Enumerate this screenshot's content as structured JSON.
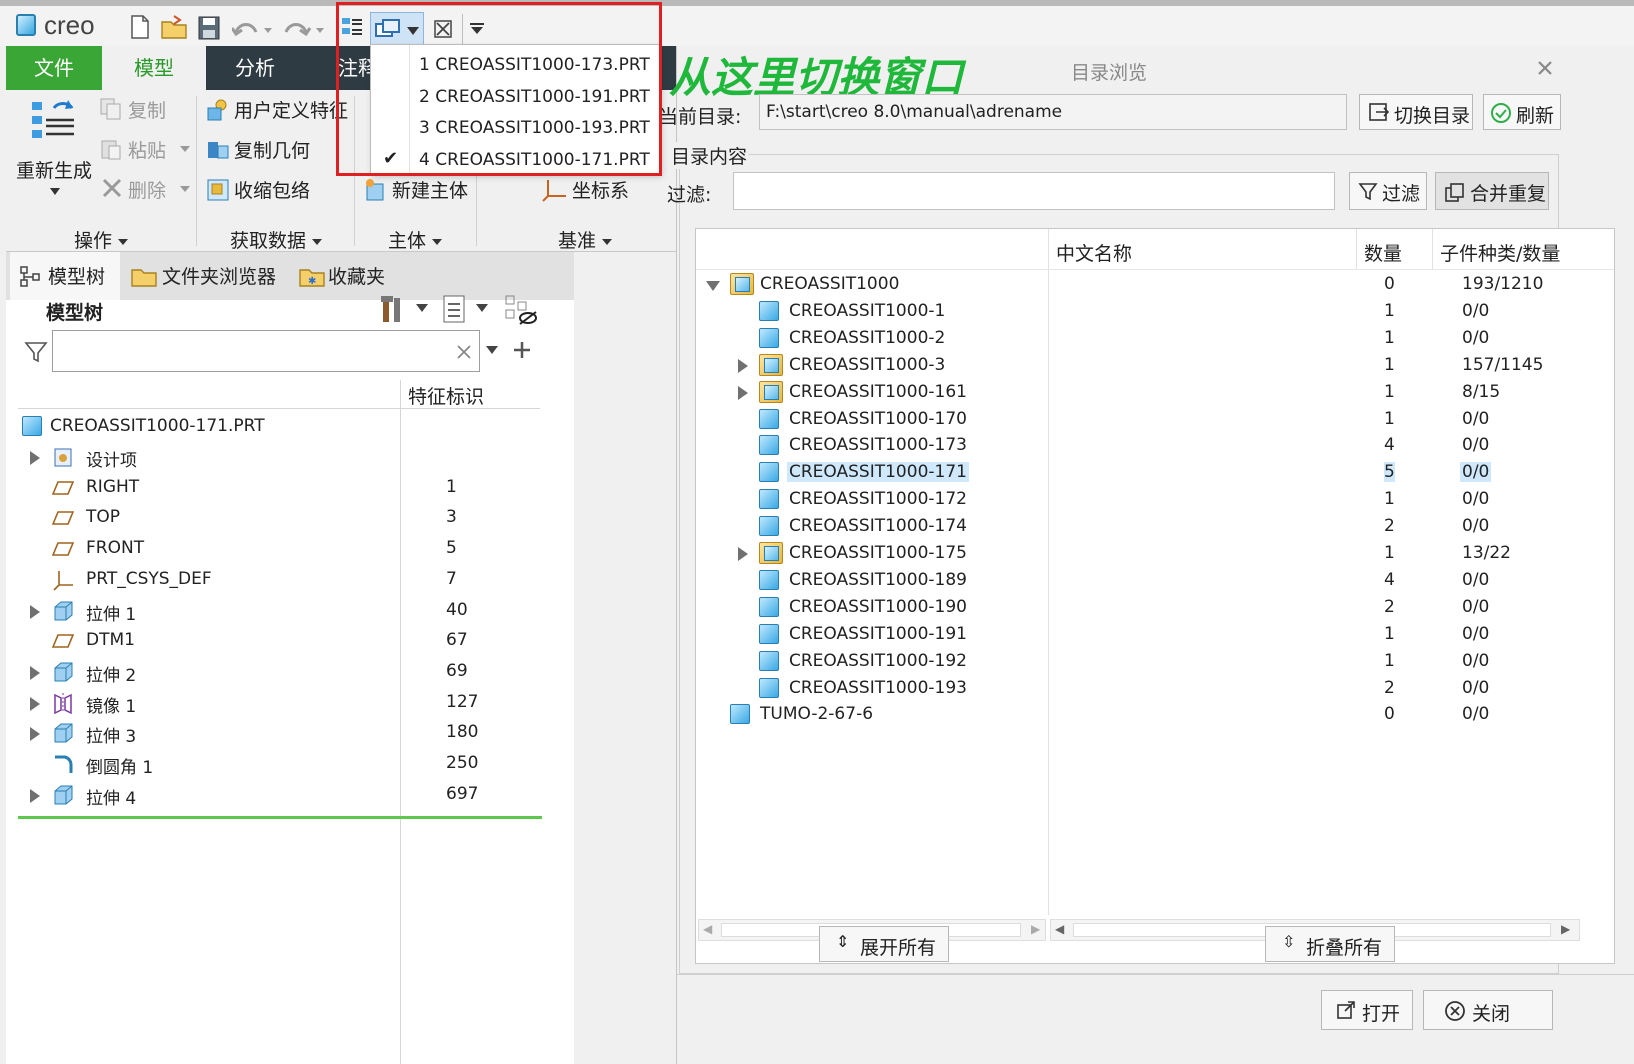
{
  "app": {
    "logo_text": "creo",
    "annotation": "从这里切换窗口"
  },
  "ribbon": {
    "tabs": [
      "文件",
      "模型",
      "分析",
      "注释"
    ],
    "buttons": {
      "regen": "重新生成",
      "copy": "复制",
      "paste": "粘贴",
      "delete": "删除",
      "udf": "用户定义特征",
      "copy_geom": "复制几何",
      "shrinkwrap": "收缩包络",
      "new_body": "新建主体",
      "csys": "坐标系"
    },
    "groups": [
      "操作",
      "获取数据",
      "主体",
      "基准"
    ]
  },
  "window_menu": {
    "items": [
      {
        "label": "1 CREOASSIT1000-173.PRT",
        "checked": false
      },
      {
        "label": "2 CREOASSIT1000-191.PRT",
        "checked": false
      },
      {
        "label": "3 CREOASSIT1000-193.PRT",
        "checked": false
      },
      {
        "label": "4 CREOASSIT1000-171.PRT",
        "checked": true
      }
    ]
  },
  "left_panel": {
    "tabs": [
      "模型树",
      "文件夹浏览器",
      "收藏夹"
    ],
    "tree_title": "模型树",
    "col_header": "特征标识",
    "search_placeholder": "",
    "root": "CREOASSIT1000-171.PRT",
    "rows": [
      {
        "label": "设计项",
        "id": "",
        "icon": "design-items-icon",
        "expand": true
      },
      {
        "label": "RIGHT",
        "id": "1",
        "icon": "datum-plane-icon",
        "expand": false
      },
      {
        "label": "TOP",
        "id": "3",
        "icon": "datum-plane-icon",
        "expand": false
      },
      {
        "label": "FRONT",
        "id": "5",
        "icon": "datum-plane-icon",
        "expand": false
      },
      {
        "label": "PRT_CSYS_DEF",
        "id": "7",
        "icon": "csys-icon",
        "expand": false
      },
      {
        "label": "拉伸 1",
        "id": "40",
        "icon": "extrude-icon",
        "expand": true
      },
      {
        "label": "DTM1",
        "id": "67",
        "icon": "datum-plane-icon",
        "expand": false
      },
      {
        "label": "拉伸 2",
        "id": "69",
        "icon": "extrude-icon",
        "expand": true
      },
      {
        "label": "镜像 1",
        "id": "127",
        "icon": "mirror-icon",
        "expand": true
      },
      {
        "label": "拉伸 3",
        "id": "180",
        "icon": "extrude-icon",
        "expand": true
      },
      {
        "label": "倒圆角 1",
        "id": "250",
        "icon": "round-icon",
        "expand": false
      },
      {
        "label": "拉伸 4",
        "id": "697",
        "icon": "extrude-icon",
        "expand": true
      }
    ]
  },
  "dialog": {
    "title": "目录浏览",
    "current_dir_label": "当前目录:",
    "current_dir": "F:\\start\\creo 8.0\\manual\\adrename",
    "switch_dir": "切换目录",
    "refresh": "刷新",
    "contents_label": "目录内容",
    "filter_label": "过滤:",
    "filter_value": "",
    "filter_btn": "过滤",
    "merge_btn": "合并重复",
    "columns": [
      "中文名称",
      "数量",
      "子件种类/数量"
    ],
    "rows": [
      {
        "name": "CREOASSIT1000",
        "count": "0",
        "sub": "193/1210",
        "level": 0,
        "type": "folder",
        "expand": "open"
      },
      {
        "name": "CREOASSIT1000-1",
        "count": "1",
        "sub": "0/0",
        "level": 1,
        "type": "part",
        "expand": ""
      },
      {
        "name": "CREOASSIT1000-2",
        "count": "1",
        "sub": "0/0",
        "level": 1,
        "type": "part",
        "expand": ""
      },
      {
        "name": "CREOASSIT1000-3",
        "count": "1",
        "sub": "157/1145",
        "level": 1,
        "type": "folder",
        "expand": "closed"
      },
      {
        "name": "CREOASSIT1000-161",
        "count": "1",
        "sub": "8/15",
        "level": 1,
        "type": "folder",
        "expand": "closed"
      },
      {
        "name": "CREOASSIT1000-170",
        "count": "1",
        "sub": "0/0",
        "level": 1,
        "type": "part",
        "expand": ""
      },
      {
        "name": "CREOASSIT1000-173",
        "count": "4",
        "sub": "0/0",
        "level": 1,
        "type": "part",
        "expand": ""
      },
      {
        "name": "CREOASSIT1000-171",
        "count": "5",
        "sub": "0/0",
        "level": 1,
        "type": "part",
        "expand": "",
        "selected": true
      },
      {
        "name": "CREOASSIT1000-172",
        "count": "1",
        "sub": "0/0",
        "level": 1,
        "type": "part",
        "expand": ""
      },
      {
        "name": "CREOASSIT1000-174",
        "count": "2",
        "sub": "0/0",
        "level": 1,
        "type": "part",
        "expand": ""
      },
      {
        "name": "CREOASSIT1000-175",
        "count": "1",
        "sub": "13/22",
        "level": 1,
        "type": "folder",
        "expand": "closed"
      },
      {
        "name": "CREOASSIT1000-189",
        "count": "4",
        "sub": "0/0",
        "level": 1,
        "type": "part",
        "expand": ""
      },
      {
        "name": "CREOASSIT1000-190",
        "count": "2",
        "sub": "0/0",
        "level": 1,
        "type": "part",
        "expand": ""
      },
      {
        "name": "CREOASSIT1000-191",
        "count": "1",
        "sub": "0/0",
        "level": 1,
        "type": "part",
        "expand": ""
      },
      {
        "name": "CREOASSIT1000-192",
        "count": "1",
        "sub": "0/0",
        "level": 1,
        "type": "part",
        "expand": ""
      },
      {
        "name": "CREOASSIT1000-193",
        "count": "2",
        "sub": "0/0",
        "level": 1,
        "type": "part",
        "expand": ""
      },
      {
        "name": "TUMO-2-67-6",
        "count": "0",
        "sub": "0/0",
        "level": 0,
        "type": "part",
        "expand": ""
      }
    ],
    "expand_all": "展开所有",
    "collapse_all": "折叠所有",
    "open": "打开",
    "close": "关闭"
  },
  "colors": {
    "file_tab": "#3aa636",
    "ribbon_dark": "#2f3b43",
    "annotation": "#1fb83b",
    "selection": "#cfe8fc",
    "highlight_box": "#e02020",
    "progress_line": "#5cc94c"
  }
}
